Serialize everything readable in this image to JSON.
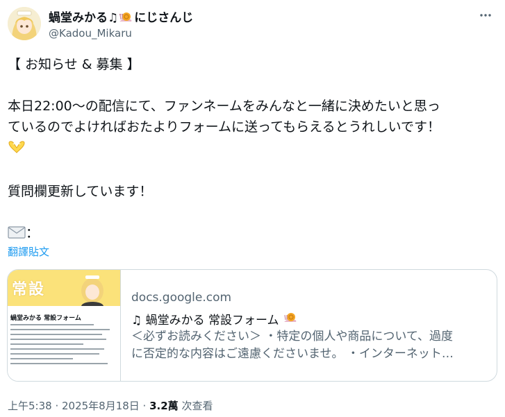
{
  "author": {
    "name_prefix": "蝸堂みかる♫",
    "name_suffix": "にじさんじ",
    "handle": "@Kadou_Mikaru"
  },
  "tweet": {
    "lines": [
      "【 お知らせ & 募集 】",
      "",
      "本日22:00〜の配信にて、ファンネームをみんなと一緒に決めたいと思っ",
      "ているのでよければおたよりフォームに送ってもらえるとうれしいです！",
      "",
      "",
      "質問欄更新しています！",
      "",
      "："
    ],
    "translate_label": "翻譯貼文"
  },
  "card": {
    "thumb_banner": "常設",
    "thumb_title": "蝸堂みかる 常設フォーム",
    "domain": "docs.google.com",
    "title": "♫ 蝸堂みかる 常設フォーム",
    "desc_line1": "＜必ずお読みください＞ ・特定の個人や商品について、過度",
    "desc_line2": "に否定的な内容はご遠慮くださいませ。 ・インターネット…"
  },
  "meta": {
    "time": "上午5:38 · 2025年8月18日 · ",
    "views": "3.2萬",
    "views_label": " 次查看"
  },
  "icons": {
    "more": "more-horizontal-icon",
    "snail": "snail-emoji-icon",
    "heart_hands": "heart-hands-emoji-icon",
    "envelope": "envelope-emoji-icon"
  }
}
